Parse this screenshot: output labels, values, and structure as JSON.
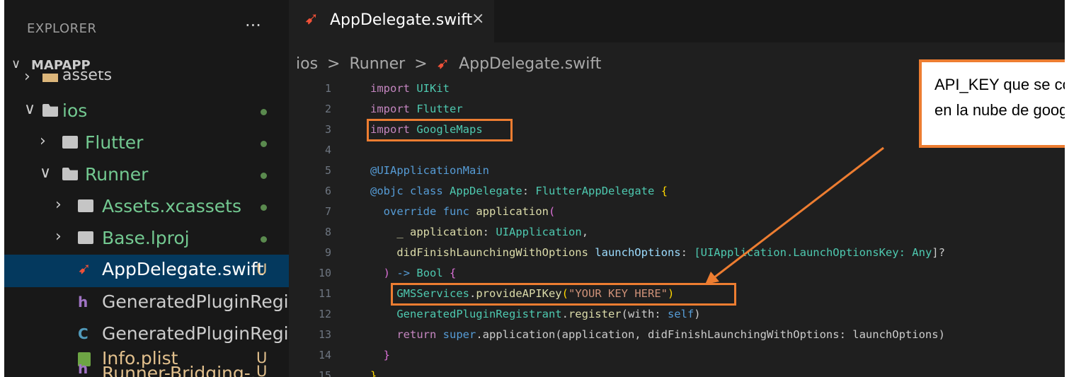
{
  "sidebar": {
    "title": "EXPLORER",
    "more": "···",
    "root": "MAPAPP",
    "items": [
      {
        "label": "assets"
      },
      {
        "label": "ios"
      },
      {
        "label": "Flutter"
      },
      {
        "label": "Runner"
      },
      {
        "label": "Assets.xcassets"
      },
      {
        "label": "Base.lproj"
      },
      {
        "label": "AppDelegate.swift",
        "badge": "U"
      },
      {
        "label": "GeneratedPluginRegistr..."
      },
      {
        "label": "GeneratedPluginRegistr..."
      },
      {
        "label": "Info.plist",
        "badge": "U"
      },
      {
        "label": "Runner-Bridging-...",
        "badge": "U"
      }
    ]
  },
  "tab": {
    "label": "AppDelegate.swift",
    "close": "×"
  },
  "breadcrumb": {
    "part1": "ios",
    "part2": "Runner",
    "part3": "AppDelegate.swift",
    "sep": ">"
  },
  "line_numbers": [
    "1",
    "2",
    "3",
    "4",
    "5",
    "6",
    "7",
    "8",
    "9",
    "10",
    "11",
    "12",
    "13",
    "14",
    "15"
  ],
  "code": {
    "l1_kw": "import",
    "l1_mod": "UIKit",
    "l2_kw": "import",
    "l2_mod": "Flutter",
    "l3_kw": "import",
    "l3_mod": "GoogleMaps",
    "l5": "@UIApplicationMain",
    "l6_attr": "@objc",
    "l6_kw": "class",
    "l6_name": "AppDelegate",
    "l6_colon": ":",
    "l6_super": "FlutterAppDelegate",
    "l6_brace": "{",
    "l7_kw1": "override",
    "l7_kw2": "func",
    "l7_fn": "application",
    "l7_paren": "(",
    "l8_under": "_",
    "l8_param": "application",
    "l8_colon": ":",
    "l8_type": "UIApplication",
    "l8_comma": ",",
    "l9_param": "didFinishLaunchingWithOptions",
    "l9_local": "launchOptions",
    "l9_colon": ":",
    "l9_type": "[UIApplication.LaunchOptionsKey:",
    "l9_any": "Any",
    "l9_end": "]?",
    "l10_paren": ")",
    "l10_arrow": "->",
    "l10_type": "Bool",
    "l10_brace": "{",
    "l11_cls": "GMSServices",
    "l11_dot": ".",
    "l11_fn": "provideAPIKey",
    "l11_open": "(",
    "l11_str": "\"YOUR KEY HERE\"",
    "l11_close": ")",
    "l12_cls": "GeneratedPluginRegistrant",
    "l12_dot": ".",
    "l12_fn": "register",
    "l12_open": "(with: ",
    "l12_self": "self",
    "l12_close": ")",
    "l13_kw": "return",
    "l13_super": "super",
    "l13_rest": ".application(application, didFinishLaunchingWithOptions: launchOptions)",
    "l14": "}",
    "l15": "}"
  },
  "callout": {
    "text": "API_KEY que se conseguirá al registrar en la nube de google"
  },
  "colors": {
    "accent": "#ed7d31",
    "swift": "#f05138",
    "selection": "#04395e"
  }
}
